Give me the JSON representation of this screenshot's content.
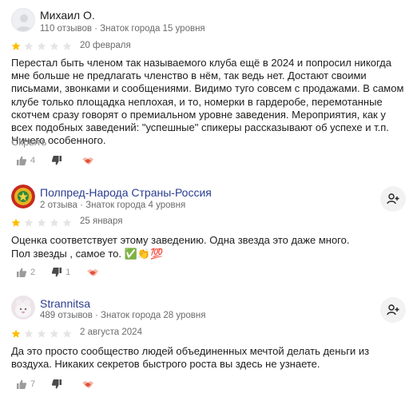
{
  "colors": {
    "star_filled": "#fdbd01",
    "star_empty": "#e5e5e5",
    "accent_link": "#2b3d8f",
    "text_secondary": "#6b6b6b",
    "icon_gray": "#9b9b9b",
    "handshake_red": "#e0543c"
  },
  "reviews": [
    {
      "author": "Михаил О.",
      "meta": "110 отзывов · Знаток города 15 уровня",
      "rating": 1,
      "rating_max": 5,
      "date": "20 февраля",
      "text": "Перестал быть членом так называемого клуба ещё в 2024 и попросил никогда мне больше не предлагать членство в нём, так ведь нет. Достают своими письмами, звонками и сообщениями. Видимо туго совсем с продажами. В самом клубе только площадка неплохая, и то, номерки в гардеробе, перемотанные скотчем сразу говорят о премиальном уровне заведения. Мероприятия, как у всех подобных заведений: \"успешные\" спикеры рассказывают об успехе и т.п. Ничего особенного.",
      "hide_label": "Скрыть",
      "likes": "4",
      "dislikes": "",
      "avatar_icon": "default-avatar-icon"
    },
    {
      "author": "Полпред-Народа Страны-Россия",
      "meta": "2 отзыва · Знаток города 4 уровня",
      "rating": 1,
      "rating_max": 5,
      "date": "25 января",
      "text_line1": "Оценка соответствует этому заведению. Одна звезда это даже много.",
      "text_line2": "Пол звезды , самое то. ✅👏💯",
      "likes": "2",
      "dislikes": "1",
      "avatar_icon": "emblem-avatar-icon"
    },
    {
      "author": "Strannitsa",
      "meta": "489 отзывов · Знаток города 28 уровня",
      "rating": 1,
      "rating_max": 5,
      "date": "2 августа 2024",
      "text": "Да это просто сообщество людей объединенных мечтой делать деньги из воздуха. Никаких секретов быстрого роста вы здесь не узнаете.",
      "likes": "7",
      "dislikes": "",
      "avatar_icon": "photo-avatar-icon"
    }
  ]
}
